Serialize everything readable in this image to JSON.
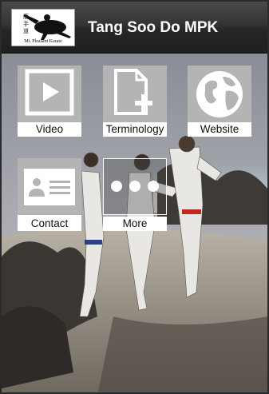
{
  "header": {
    "title": "Tang Soo Do MPK",
    "logo_caption": "Mt. Pleasant Karate"
  },
  "tiles": [
    {
      "label": "Video",
      "icon": "play-video-icon"
    },
    {
      "label": "Terminology",
      "icon": "add-document-icon"
    },
    {
      "label": "Website",
      "icon": "globe-icon"
    },
    {
      "label": "Contact",
      "icon": "contact-card-icon"
    },
    {
      "label": "More",
      "icon": "three-dots-icon"
    }
  ],
  "colors": {
    "header": "#2b2b2b",
    "title_text": "#ffffff",
    "tile_background": "#b4b4b4",
    "tile_label_background": "#ffffff"
  }
}
